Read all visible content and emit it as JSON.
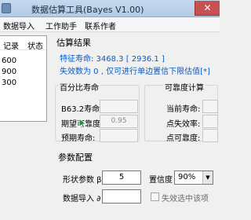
{
  "window": {
    "title": "数据估算工具(Bayes V1.00)",
    "close_glyph": "✕"
  },
  "menu": {
    "items": [
      "数据导入",
      "工作助手",
      "联系作者"
    ]
  },
  "left_panel": {
    "columns": [
      "记录",
      "状态"
    ],
    "rows": [
      "600",
      "900",
      "300"
    ]
  },
  "results": {
    "title": "估算结果",
    "characteristic_life": "特征寿命: 3468.3  [ 2936.1 ]",
    "failure_line": "失效数为 0 , 仅可进行单边置信下限估值[*]"
  },
  "percentile_life": {
    "title": "百分比寿命",
    "b632_label": "B63.2寿命:",
    "b632_value": "",
    "reliability_label": "期望可靠度:",
    "reliability_value": "0.95",
    "expected_life_label": "预期寿命:",
    "expected_life_value": ""
  },
  "reliability_calc": {
    "title": "可靠度计算",
    "current_life_label": "当前寿命:",
    "current_life_value": "",
    "point_failure_label": "点失效率:",
    "point_failure_value": "",
    "point_reliability_label": "点可靠度:",
    "point_reliability_value": ""
  },
  "params": {
    "title": "参数配置",
    "shape_label": "形状参数 β",
    "shape_value": "5",
    "confidence_label": "置信度",
    "confidence_value": "90%",
    "data_import_label": "数据导入 ∂",
    "data_import_value": "",
    "failure_checkbox_label": "失效选中该项",
    "failure_checkbox_checked": false
  },
  "colors": {
    "result_text": "#0a5cc4"
  },
  "icons": {
    "app": "app-icon",
    "cursor": "arrow-cursor-icon"
  }
}
